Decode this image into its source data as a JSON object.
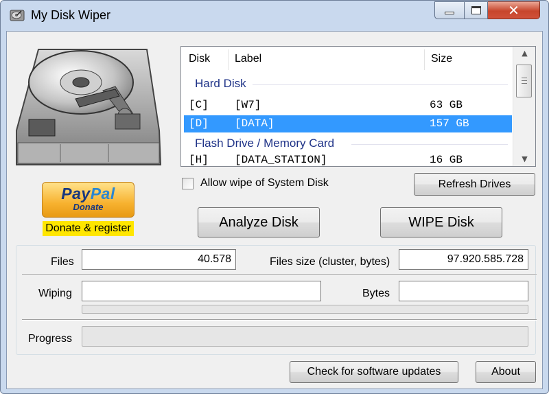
{
  "window": {
    "title": "My Disk Wiper",
    "close_glyph": "✕"
  },
  "donate": {
    "paypal_part1": "Pay",
    "paypal_part2": "Pal",
    "paypal_sub": "Donate",
    "label": "Donate & register"
  },
  "drives": {
    "columns": [
      "Disk",
      "Label",
      "Size"
    ],
    "groups": [
      {
        "name": "Hard Disk",
        "rows": [
          {
            "disk": "[C]",
            "label": "[W7]",
            "size": "63 GB",
            "strikethrough": true,
            "selected": false
          },
          {
            "disk": "[D]",
            "label": "[DATA]",
            "size": "157 GB",
            "strikethrough": false,
            "selected": true
          }
        ]
      },
      {
        "name": "Flash Drive / Memory Card",
        "rows": [
          {
            "disk": "[H]",
            "label": "[DATA_STATION]",
            "size": "16 GB",
            "strikethrough": false,
            "selected": false
          }
        ]
      }
    ]
  },
  "options": {
    "allow_system_wipe_label": "Allow wipe of System Disk",
    "allow_system_wipe_checked": false
  },
  "buttons": {
    "refresh": "Refresh Drives",
    "analyze": "Analyze Disk",
    "wipe": "WIPE Disk",
    "update": "Check for software updates",
    "about": "About"
  },
  "stats": {
    "files_label": "Files",
    "files_value": "40.578",
    "files_size_label": "Files size (cluster, bytes)",
    "files_size_value": "97.920.585.728",
    "wiping_label": "Wiping",
    "wiping_value": "",
    "bytes_label": "Bytes",
    "bytes_value": "",
    "progress_label": "Progress",
    "wiping_progress": 0,
    "progress": 0
  },
  "colors": {
    "selection": "#3399ff",
    "group_header": "#1e3287",
    "donate_highlight": "#ffe600"
  }
}
